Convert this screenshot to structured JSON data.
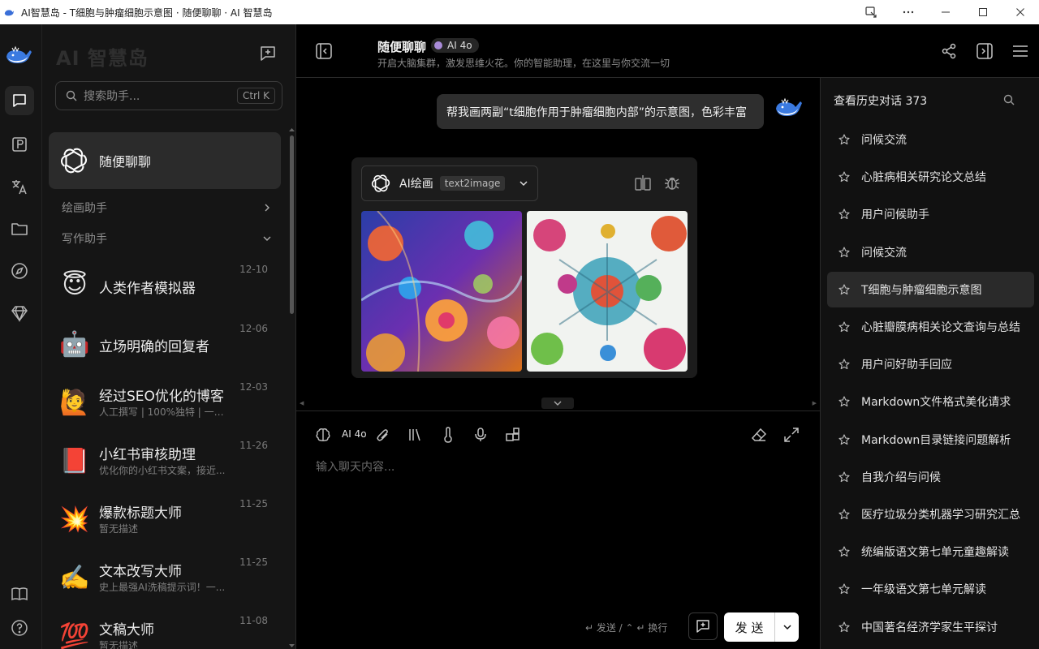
{
  "window": {
    "title": "AI智慧岛 - T细胞与肿瘤细胞示意图 · 随便聊聊 · AI 智慧岛"
  },
  "panel": {
    "title": "AI 智慧岛",
    "search_placeholder": "搜索助手...",
    "search_shortcut": "Ctrl K",
    "selected": {
      "name": "随便聊聊"
    },
    "groups": [
      {
        "label": "绘画助手",
        "state": "collapsed"
      },
      {
        "label": "写作助手",
        "state": "expanded"
      }
    ],
    "assistants": [
      {
        "name": "人类作者模拟器",
        "desc": "",
        "date": "12-10",
        "icon": "😇"
      },
      {
        "name": "立场明确的回复者",
        "desc": "",
        "date": "12-06",
        "icon": "🤖"
      },
      {
        "name": "经过SEO优化的博客",
        "desc": "人工撰写 | 100%独特 | 一位...",
        "date": "12-03",
        "icon": "🙋"
      },
      {
        "name": "小红书审核助理",
        "desc": "优化你的小红书文案，接近...",
        "date": "11-26",
        "icon": "📕"
      },
      {
        "name": "爆款标题大师",
        "desc": "暂无描述",
        "date": "11-25",
        "icon": "💥"
      },
      {
        "name": "文本改写大师",
        "desc": "史上最强AI洗稿提示词！一...",
        "date": "11-25",
        "icon": "✍️"
      },
      {
        "name": "文稿大师",
        "desc": "暂无描述",
        "date": "11-08",
        "icon": "💯"
      }
    ]
  },
  "header": {
    "title": "随便聊聊",
    "model": "AI 4o",
    "subtitle": "开启大脑集群，激发思维火花。你的智能助理，在这里与你交流一切"
  },
  "chat": {
    "user_message": "帮我画两副“t细胞作用于肿瘤细胞内部”的示意图，色彩丰富",
    "plugin": {
      "name": "AI绘画",
      "tag": "text2image"
    }
  },
  "input": {
    "model_label": "AI 4o",
    "placeholder": "输入聊天内容...",
    "hint": "↵ 发送 / ⌃ ↵ 换行",
    "send_label": "发 送"
  },
  "history": {
    "header": "查看历史对话 373",
    "active_index": 4,
    "items": [
      "问候交流",
      "心脏病相关研究论文总结",
      "用户问候助手",
      "问候交流",
      "T细胞与肿瘤细胞示意图",
      "心脏瓣膜病相关论文查询与总结",
      "用户问好助手回应",
      "Markdown文件格式美化请求",
      "Markdown目录链接问题解析",
      "自我介绍与问候",
      "医疗垃圾分类机器学习研究汇总",
      "统编版语文第七单元童趣解读",
      "一年级语文第七单元解读",
      "中国著名经济学家生平探讨"
    ]
  }
}
